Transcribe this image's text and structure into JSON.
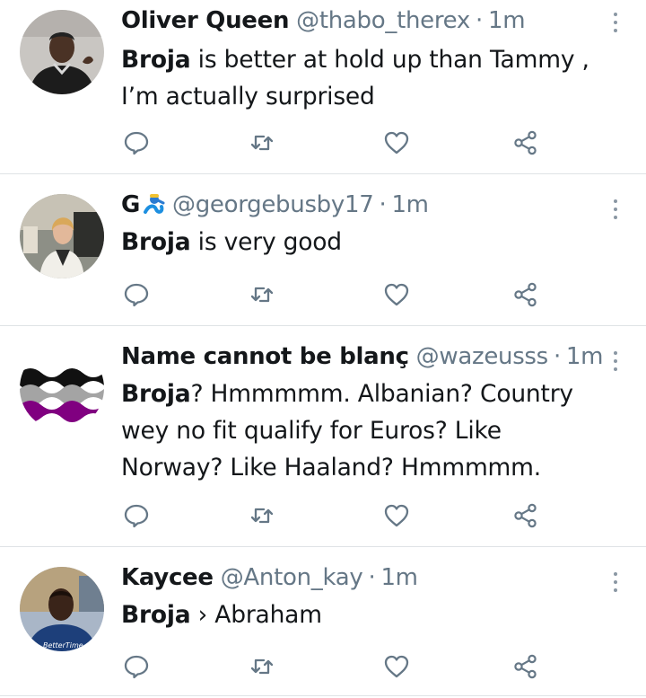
{
  "tweets": [
    {
      "name": "Oliver Queen",
      "handle": "@thabo_therex",
      "time": "1m",
      "text_bold": "Broja",
      "text_rest": " is better at hold up than Tammy , I’m actually surprised"
    },
    {
      "name": "G",
      "handle": "@georgebusby17",
      "time": "1m",
      "text_bold": "Broja",
      "text_rest": " is very good"
    },
    {
      "name": "Name cannot be blanç",
      "handle": "@wazeusss",
      "time": "1m",
      "text_bold": "Broja",
      "text_rest": "? Hmmmmm. Albanian? Country wey no fit qualify for Euros? Like Norway? Like Haaland? Hmmmmm."
    },
    {
      "name": "Kaycee",
      "handle": "@Anton_kay",
      "time": "1m",
      "text_bold": "Broja",
      "text_rest": " › Abraham"
    }
  ],
  "separator": "·",
  "icons": {
    "reply": "reply-icon",
    "retweet": "retweet-icon",
    "like": "heart-icon",
    "share": "share-icon",
    "more": "more-vertical-icon"
  },
  "colors": {
    "icon": "#657786",
    "divider": "#dfe3e6",
    "text": "#14171a",
    "secondary": "#657786"
  }
}
